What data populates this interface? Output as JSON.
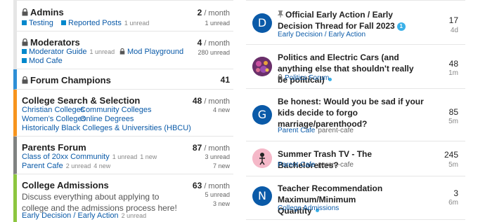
{
  "categories": [
    {
      "title": "Admins",
      "locked": true,
      "color": "#e6e6e6",
      "stat_count": "2",
      "stat_period": "/ month",
      "stat_sub": "1 unread",
      "subs": [
        {
          "label": "Testing",
          "dot_color": "#0088cc"
        },
        {
          "label": "Reported Posts",
          "dot_color": "#0088cc",
          "count": "1 unread"
        }
      ]
    },
    {
      "title": "Moderators",
      "locked": true,
      "color": "#e6e6e6",
      "stat_count": "4",
      "stat_period": "/ month",
      "stat_sub": "280 unread",
      "subs": [
        {
          "label": "Moderator Guide",
          "dot_color": "#0088cc",
          "count": "1 unread"
        },
        {
          "label": "Mod Playground",
          "locked": true
        },
        {
          "label": "Mod Cafe",
          "dot_color": "#0088cc"
        }
      ]
    },
    {
      "title": "Forum Champions",
      "locked": true,
      "color": "#2e8fd6",
      "stat_count": "41"
    },
    {
      "title": "College Search & Selection",
      "locked": false,
      "color": "#f7941d",
      "stat_count": "48",
      "stat_period": "/ month",
      "stat_sub": "4 new",
      "subs": [
        {
          "label": "Christian Colleges"
        },
        {
          "label": "Community Colleges"
        },
        {
          "label": "Women's Colleges"
        },
        {
          "label": "Online Degrees"
        },
        {
          "label": "Historically Black Colleges & Universities (HBCU)"
        }
      ]
    },
    {
      "title": "Parents Forum",
      "locked": false,
      "color": "#808281",
      "stat_count": "87",
      "stat_period": "/ month",
      "stat_sub": "3 unread",
      "stat_sub2": "7 new",
      "subs": [
        {
          "label": "Class of 20xx Community",
          "count": "1 unread",
          "count2": "1 new"
        },
        {
          "label": "Parent Cafe",
          "count": "2 unread",
          "count2": "4 new"
        }
      ]
    },
    {
      "title": "College Admissions",
      "locked": false,
      "color": "#8dc63f",
      "description": "Discuss everything about applying to college and the admissions process here!",
      "stat_count": "63",
      "stat_period": "/ month",
      "stat_sub": "5 unread",
      "stat_sub2": "3 new",
      "subs": [
        {
          "label": "Early Decision / Early Action",
          "count": "2 unread"
        }
      ]
    }
  ],
  "topics": [
    {
      "avatar_letter": "D",
      "avatar_color": "#0a5aa8",
      "pinned": true,
      "title": "Official Early Action / Early Decision Thread for Fall 2023",
      "badge": "1",
      "category": "Early Decision / Early Action",
      "category_color": "#0088cc",
      "replies": "17",
      "age": "4d"
    },
    {
      "avatar_letter": "",
      "avatar_color": "#7a3b7a",
      "title": "Politics and Electric Cars (and anything else that shouldn't really be political)",
      "unread": true,
      "category": "Politics Forum",
      "category_locked": true,
      "replies": "48",
      "age": "1m"
    },
    {
      "avatar_letter": "G",
      "avatar_color": "#0a5aa8",
      "title": "Be honest: Would you be sad if your kids decide to forgo marriage/parenthood?",
      "category": "Parent Cafe",
      "category_color": "#0088cc",
      "tag": "parent-cafe",
      "replies": "85",
      "age": "5m"
    },
    {
      "avatar_letter": "",
      "avatar_color": "#f5b8c8",
      "title": "Summer Trash TV - The Bachelorettes?",
      "category": "Parent Cafe",
      "category_color": "#0088cc",
      "tag": "parent-cafe",
      "replies": "245",
      "age": "5m"
    },
    {
      "avatar_letter": "N",
      "avatar_color": "#0a5aa8",
      "title": "Teacher Recommendation Maximum/Minimum Quantity",
      "unread": true,
      "category": "College Admissions",
      "category_color": "#8dc63f",
      "replies": "3",
      "age": "6m"
    }
  ]
}
